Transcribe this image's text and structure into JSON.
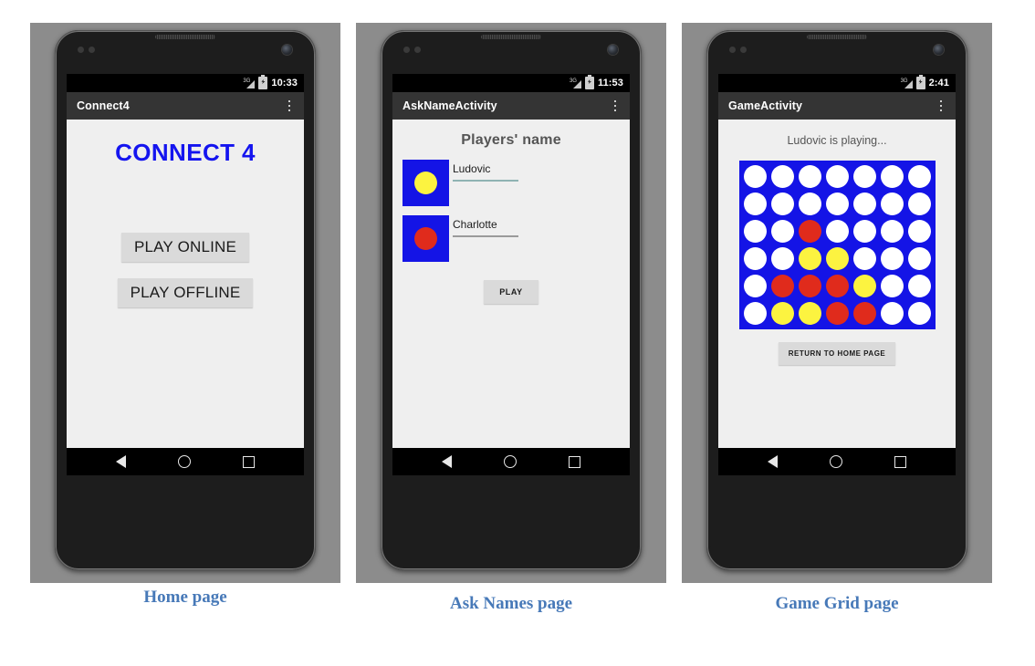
{
  "figures": [
    {
      "caption": "Home page",
      "status_bar": {
        "network": "3G",
        "signal_icon": "signal-triangle-icon",
        "battery_icon": "battery-icon",
        "time": "10:33"
      },
      "action_bar": {
        "title": "Connect4",
        "overflow_icon": "overflow-menu-icon"
      },
      "screen": {
        "app_title": "CONNECT 4",
        "app_title_color": "#1414ef",
        "buttons": [
          {
            "label": "PLAY ONLINE"
          },
          {
            "label": "PLAY OFFLINE"
          }
        ]
      },
      "nav_bar": {
        "back": "back-icon",
        "home": "home-icon",
        "recents": "recents-icon"
      }
    },
    {
      "caption": "Ask Names page",
      "status_bar": {
        "network": "3G",
        "signal_icon": "signal-triangle-icon",
        "battery_icon": "battery-icon",
        "time": "11:53"
      },
      "action_bar": {
        "title": "AskNameActivity",
        "overflow_icon": "overflow-menu-icon"
      },
      "screen": {
        "heading": "Players' name",
        "players": [
          {
            "token_color": "#fcf340",
            "token_name": "yellow-token",
            "name_value": "Ludovic",
            "underline_color": "#8fb3b3"
          },
          {
            "token_color": "#e02b1c",
            "token_name": "red-token",
            "name_value": "Charlotte",
            "underline_color": "#9a9a9a"
          }
        ],
        "play_button": "PLAY"
      },
      "nav_bar": {
        "back": "back-icon",
        "home": "home-icon",
        "recents": "recents-icon"
      }
    },
    {
      "caption": "Game Grid page",
      "status_bar": {
        "network": "3G",
        "signal_icon": "signal-triangle-icon",
        "battery_icon": "battery-icon",
        "time": "2:41"
      },
      "action_bar": {
        "title": "GameActivity",
        "overflow_icon": "overflow-menu-icon"
      },
      "screen": {
        "turn_message": "Ludovic is playing...",
        "return_button": "RETURN TO HOME PAGE"
      },
      "nav_bar": {
        "back": "back-icon",
        "home": "home-icon",
        "recents": "recents-icon"
      }
    }
  ],
  "board": {
    "columns": 7,
    "rows": 6,
    "board_color": "#1414e6",
    "empty_color": "#ffffff",
    "red_color": "#e02b1c",
    "yellow_color": "#fcf340",
    "cells": [
      [
        "empty",
        "empty",
        "empty",
        "empty",
        "empty",
        "empty",
        "empty"
      ],
      [
        "empty",
        "empty",
        "empty",
        "empty",
        "empty",
        "empty",
        "empty"
      ],
      [
        "empty",
        "empty",
        "red",
        "empty",
        "empty",
        "empty",
        "empty"
      ],
      [
        "empty",
        "empty",
        "yellow",
        "yellow",
        "empty",
        "empty",
        "empty"
      ],
      [
        "empty",
        "red",
        "red",
        "red",
        "yellow",
        "empty",
        "empty"
      ],
      [
        "empty",
        "yellow",
        "yellow",
        "red",
        "red",
        "empty",
        "empty"
      ]
    ]
  },
  "theme": {
    "backdrop": "#8c8c8c",
    "status_bar_bg": "#000000",
    "action_bar_bg": "#343434",
    "content_bg": "#efefef",
    "button_bg": "#dadada",
    "caption_color": "#4779b8"
  }
}
